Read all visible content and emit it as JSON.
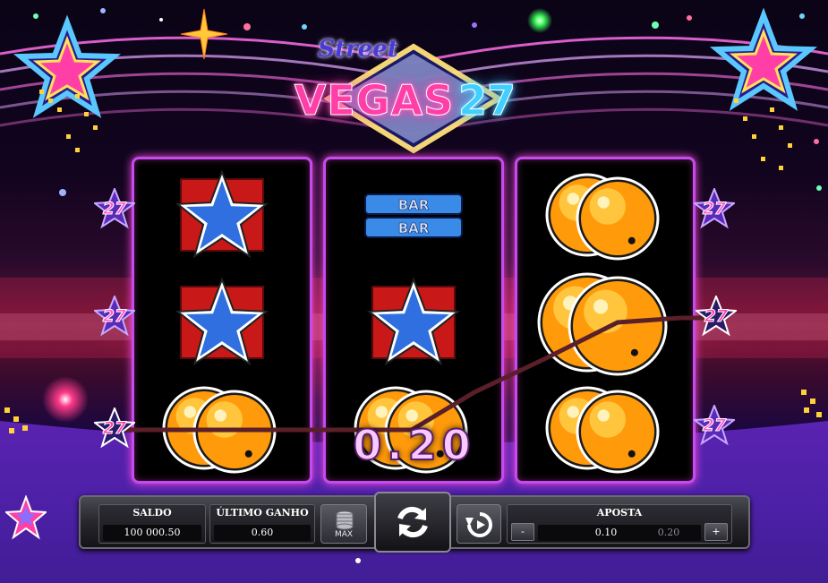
{
  "game": {
    "logo": {
      "street": "Street",
      "vegas": "VEGAS",
      "number": "27"
    }
  },
  "reels": [
    {
      "symbols": [
        "blue-star",
        "blue-star",
        "orange-ball"
      ]
    },
    {
      "symbols": [
        "double-bar",
        "blue-star",
        "orange-ball"
      ]
    },
    {
      "symbols": [
        "orange-ball",
        "orange-ball",
        "orange-ball"
      ]
    }
  ],
  "bar_symbol": {
    "line1": "BAR",
    "line2": "BAR"
  },
  "line_badges": {
    "left": [
      "27",
      "27",
      "27"
    ],
    "right": [
      "27",
      "27",
      "27"
    ]
  },
  "win": {
    "amount": "0.20"
  },
  "controls": {
    "saldo": {
      "label": "SALDO",
      "value": "100 000.50"
    },
    "ultimo_ganho": {
      "label": "ÚLTIMO GANHO",
      "value": "0.60"
    },
    "max_label": "MAX",
    "aposta": {
      "label": "APOSTA",
      "minus": "-",
      "plus": "+",
      "selected": "0.10",
      "next": "0.20"
    }
  },
  "colors": {
    "reel_border": "#c54af0",
    "star_blue": "#2f6fe0",
    "square_red": "#c81818",
    "ball_orange": "#ff9a0a",
    "payline": "#5a1f28"
  }
}
